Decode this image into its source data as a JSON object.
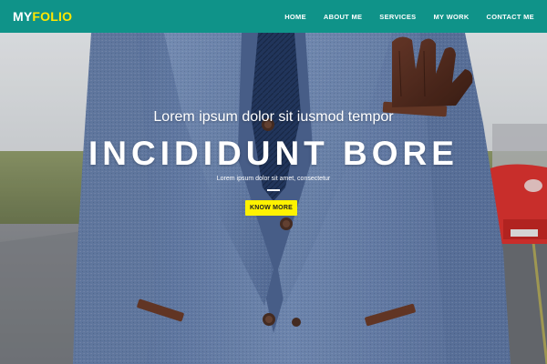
{
  "brand": {
    "logo_part1": "MY",
    "logo_part2": "FOLIO"
  },
  "nav": {
    "items": [
      {
        "label": "HOME"
      },
      {
        "label": "ABOUT ME"
      },
      {
        "label": "SERVICES"
      },
      {
        "label": "MY WORK"
      },
      {
        "label": "CONTACT ME"
      }
    ]
  },
  "hero": {
    "subtitle": "Lorem ipsum dolor sit iusmod tempor",
    "title": "INCIDIDUNT BORE",
    "small_text": "Lorem ipsum dolor sit amet, consectetur",
    "cta_label": "KNOW MORE"
  },
  "colors": {
    "navbar": "#0f9389",
    "logo_accent": "#ffe600",
    "cta": "#fff200"
  }
}
